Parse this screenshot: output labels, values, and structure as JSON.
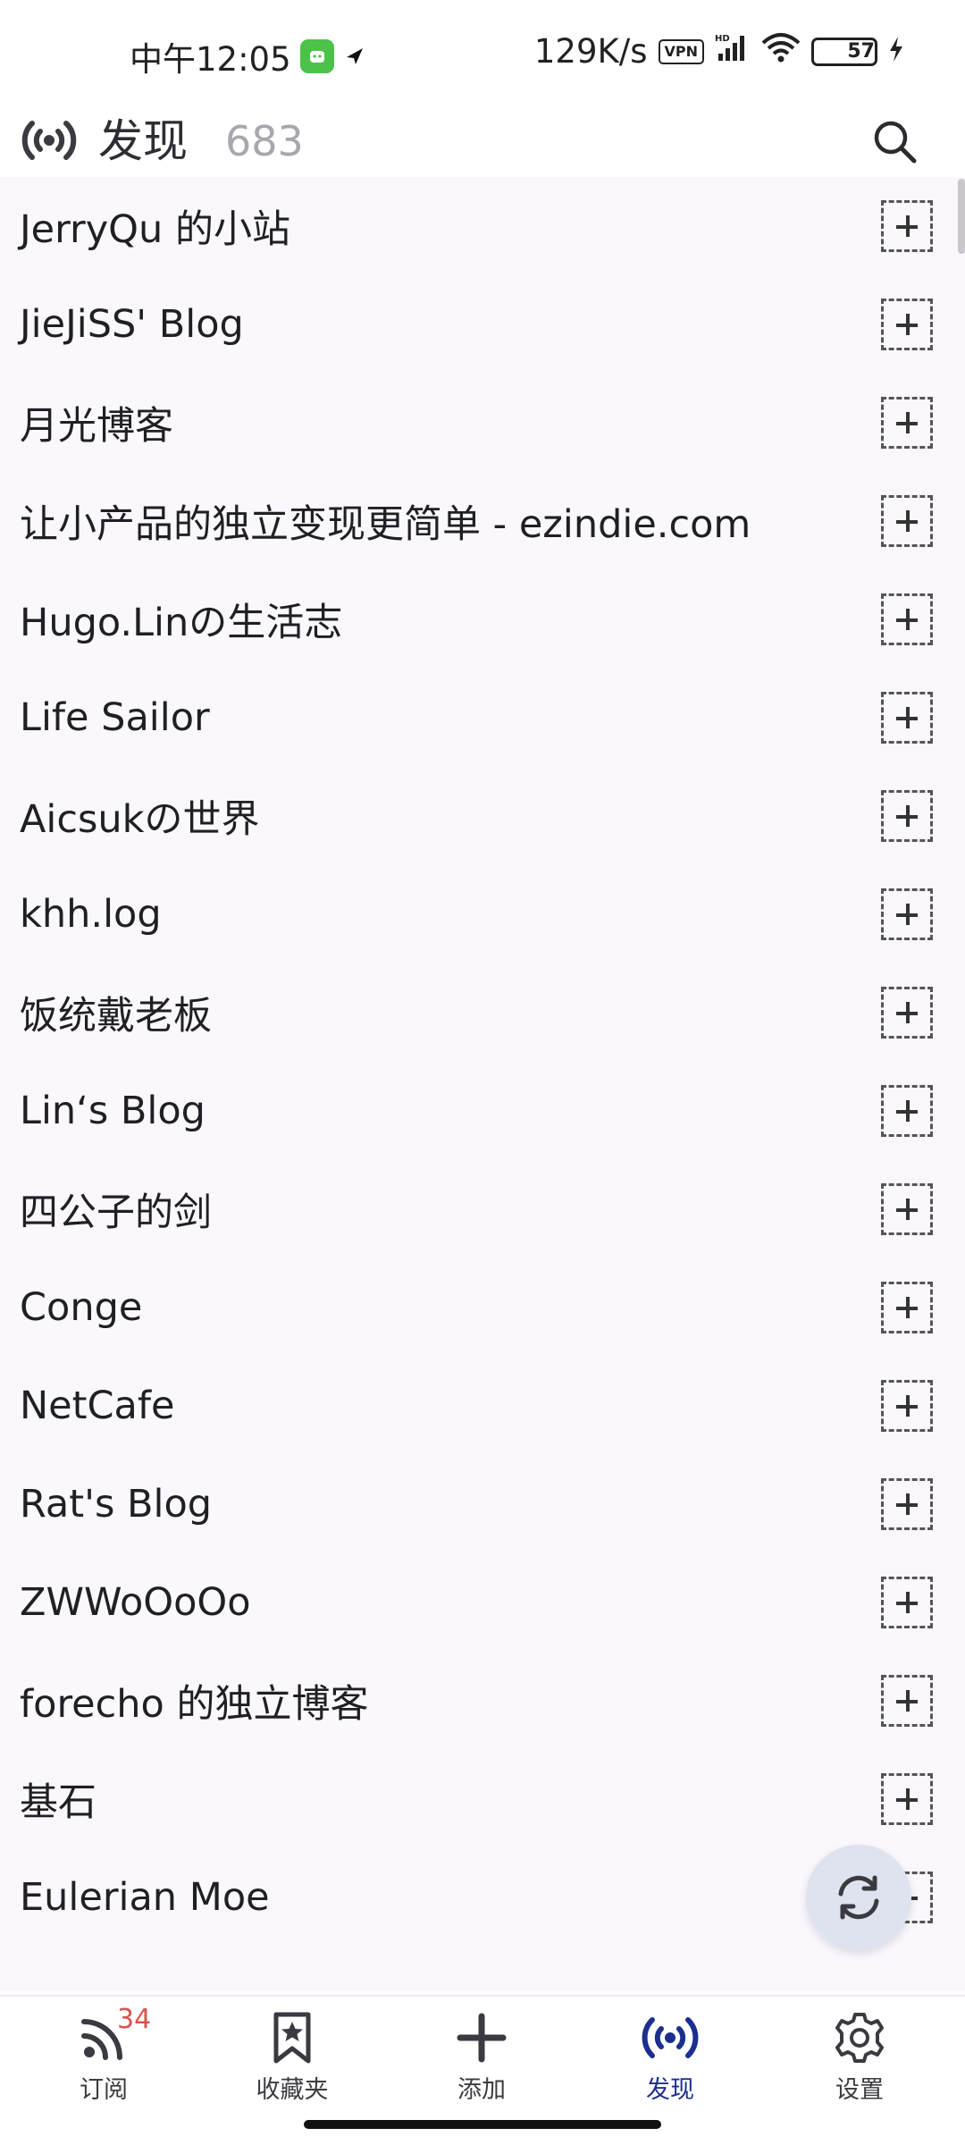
{
  "status_bar": {
    "time": "中午12:05",
    "speed": "129K/s",
    "vpn": "VPN",
    "hd": "HD",
    "battery": "57"
  },
  "header": {
    "title": "发现",
    "count": "683"
  },
  "list": {
    "items": [
      {
        "label": "JerryQu 的小站"
      },
      {
        "label": "JieJiSS' Blog"
      },
      {
        "label": "月光博客"
      },
      {
        "label": "让小产品的独立变现更简单 - ezindie.com"
      },
      {
        "label": "Hugo.Linの生活志"
      },
      {
        "label": "Life Sailor"
      },
      {
        "label": "Aicsukの世界"
      },
      {
        "label": "khh.log"
      },
      {
        "label": "饭统戴老板"
      },
      {
        "label": "Lin‘s Blog"
      },
      {
        "label": "四公子的剑"
      },
      {
        "label": "Conge"
      },
      {
        "label": "NetCafe"
      },
      {
        "label": "Rat's Blog"
      },
      {
        "label": "ZWWoOoOo"
      },
      {
        "label": "forecho 的独立博客"
      },
      {
        "label": "基石"
      },
      {
        "label": "Eulerian Moe"
      }
    ]
  },
  "bottom_nav": {
    "items": [
      {
        "label": "订阅",
        "badge": "34",
        "icon": "rss-icon"
      },
      {
        "label": "收藏夹",
        "icon": "bookmark-star-icon"
      },
      {
        "label": "添加",
        "icon": "plus-icon"
      },
      {
        "label": "发现",
        "icon": "broadcast-icon",
        "active": true
      },
      {
        "label": "设置",
        "icon": "gear-icon"
      }
    ]
  },
  "colors": {
    "accent": "#1c2f8f",
    "badge": "#d9534f",
    "list_bg": "#faf8fd",
    "fab_bg": "#dfe3f0"
  }
}
